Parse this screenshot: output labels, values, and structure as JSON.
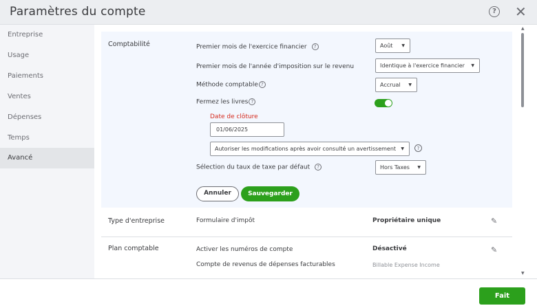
{
  "header": {
    "title": "Paramètres du compte",
    "help_glyph": "?",
    "close_glyph": "✕"
  },
  "sidebar": {
    "items": [
      {
        "label": "Entreprise",
        "active": false
      },
      {
        "label": "Usage",
        "active": false
      },
      {
        "label": "Paiements",
        "active": false
      },
      {
        "label": "Ventes",
        "active": false
      },
      {
        "label": "Dépenses",
        "active": false
      },
      {
        "label": "Temps",
        "active": false
      },
      {
        "label": "Avancé",
        "active": true
      }
    ]
  },
  "comptabilite": {
    "section_label": "Comptabilité",
    "first_month_fiscal_label": "Premier mois de l'exercice financier",
    "first_month_fiscal_value": "Août",
    "first_month_tax_label": "Premier mois de l'année d'imposition sur le revenu",
    "first_month_tax_value": "Identique à l'exercice financier",
    "accounting_method_label": "Méthode comptable",
    "accounting_method_value": "Accrual",
    "close_books_label": "Fermez les livres",
    "close_books_on": true,
    "closing_date_label": "Date de clôture",
    "closing_date_value": "01/06/2025",
    "modifications_value": "Autoriser les modifications après avoir consulté un avertissement",
    "default_tax_label": "Sélection du taux de taxe par défaut",
    "default_tax_value": "Hors Taxes",
    "cancel_label": "Annuler",
    "save_label": "Sauvegarder"
  },
  "type_entreprise": {
    "section_label": "Type d'entreprise",
    "field_label": "Formulaire d'impôt",
    "field_value": "Propriétaire unique"
  },
  "plan_comptable": {
    "section_label": "Plan comptable",
    "account_numbers_label": "Activer les numéros de compte",
    "account_numbers_value": "Désactivé",
    "billable_label": "Compte de revenus de dépenses facturables",
    "billable_value": "Billable Expense Income"
  },
  "footer": {
    "done_label": "Fait"
  },
  "colors": {
    "accent_green": "#2ca01c",
    "error_red": "#d52b1e",
    "panel_bg": "#f3f7fe"
  },
  "icons": [
    "help-icon",
    "close-icon",
    "question-icon",
    "chevron-down-icon",
    "pencil-icon",
    "scroll-up-icon",
    "scroll-down-icon"
  ]
}
